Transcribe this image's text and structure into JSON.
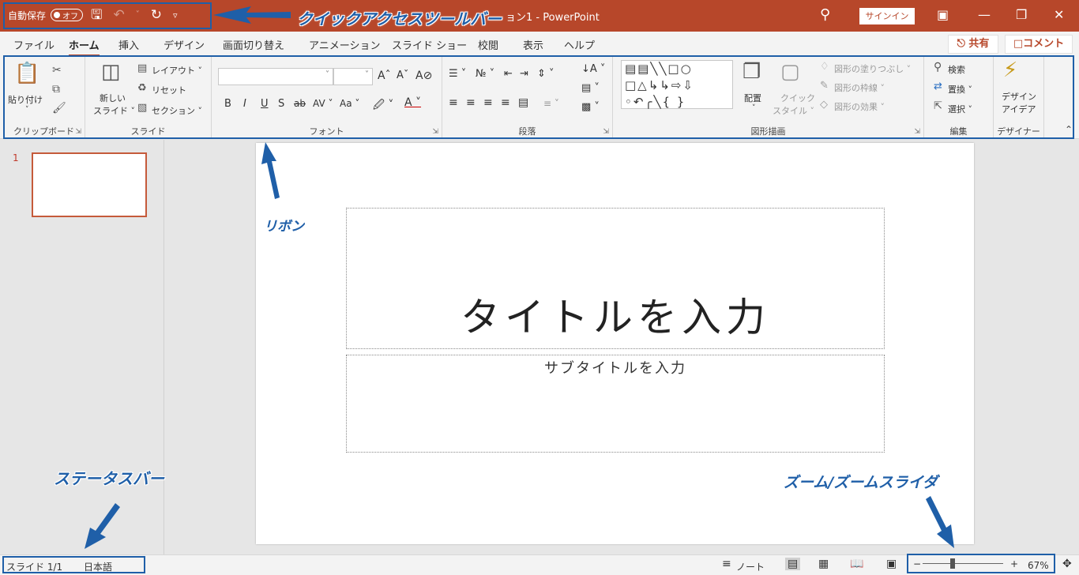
{
  "quick_access": {
    "autosave_label": "自動保存",
    "autosave_state": "オフ",
    "save_icon": "save-icon",
    "undo_icon": "undo-icon",
    "redo_icon": "redo-icon",
    "customize_icon": "customize-icon"
  },
  "title": {
    "document": "ョン1 - PowerPoint",
    "signin": "サインイン"
  },
  "tabs": [
    "ファイル",
    "ホーム",
    "挿入",
    "デザイン",
    "画面切り替え",
    "アニメーション",
    "スライド ショー",
    "校閲",
    "表示",
    "ヘルプ"
  ],
  "share_label": "共有",
  "comment_label": "コメント",
  "ribbon": {
    "clipboard": {
      "paste": "貼り付け",
      "label": "クリップボード"
    },
    "slides": {
      "new_slide_1": "新しい",
      "new_slide_2": "スライド ˅",
      "layout": "レイアウト ˅",
      "reset": "リセット",
      "section": "セクション ˅",
      "label": "スライド"
    },
    "font": {
      "label": "フォント",
      "bold": "B",
      "italic": "I",
      "underline": "U",
      "strike": "S",
      "case": "Aa ˅"
    },
    "paragraph": {
      "label": "段落"
    },
    "drawing": {
      "arrange": "配置",
      "quick_1": "クイック",
      "quick_2": "スタイル ˅",
      "fill": "図形の塗りつぶし ˅",
      "outline": "図形の枠線 ˅",
      "effect": "図形の効果 ˅",
      "label": "図形描画"
    },
    "editing": {
      "find": "検索",
      "replace": "置換 ˅",
      "select": "選択 ˅",
      "label": "編集"
    },
    "designer": {
      "ideas_1": "デザイン",
      "ideas_2": "アイデア",
      "label": "デザイナー"
    }
  },
  "slides": {
    "number": "1",
    "title_placeholder": "タイトルを入力",
    "subtitle_placeholder": "サブタイトルを入力"
  },
  "status": {
    "slide": "スライド 1/1",
    "language": "日本語",
    "notes": "ノート",
    "zoom_minus": "−",
    "zoom_plus": "+",
    "zoom_percent": "67%",
    "zoom_value": 0.67
  },
  "annotations": {
    "qat": "クイックアクセスツールバー",
    "ribbon": "リボン",
    "statusbar": "ステータスバー",
    "zoom": "ズーム/ズームスライダ"
  },
  "colors": {
    "title_bar": "#b7472a",
    "annotation": "#1f5fa8"
  }
}
